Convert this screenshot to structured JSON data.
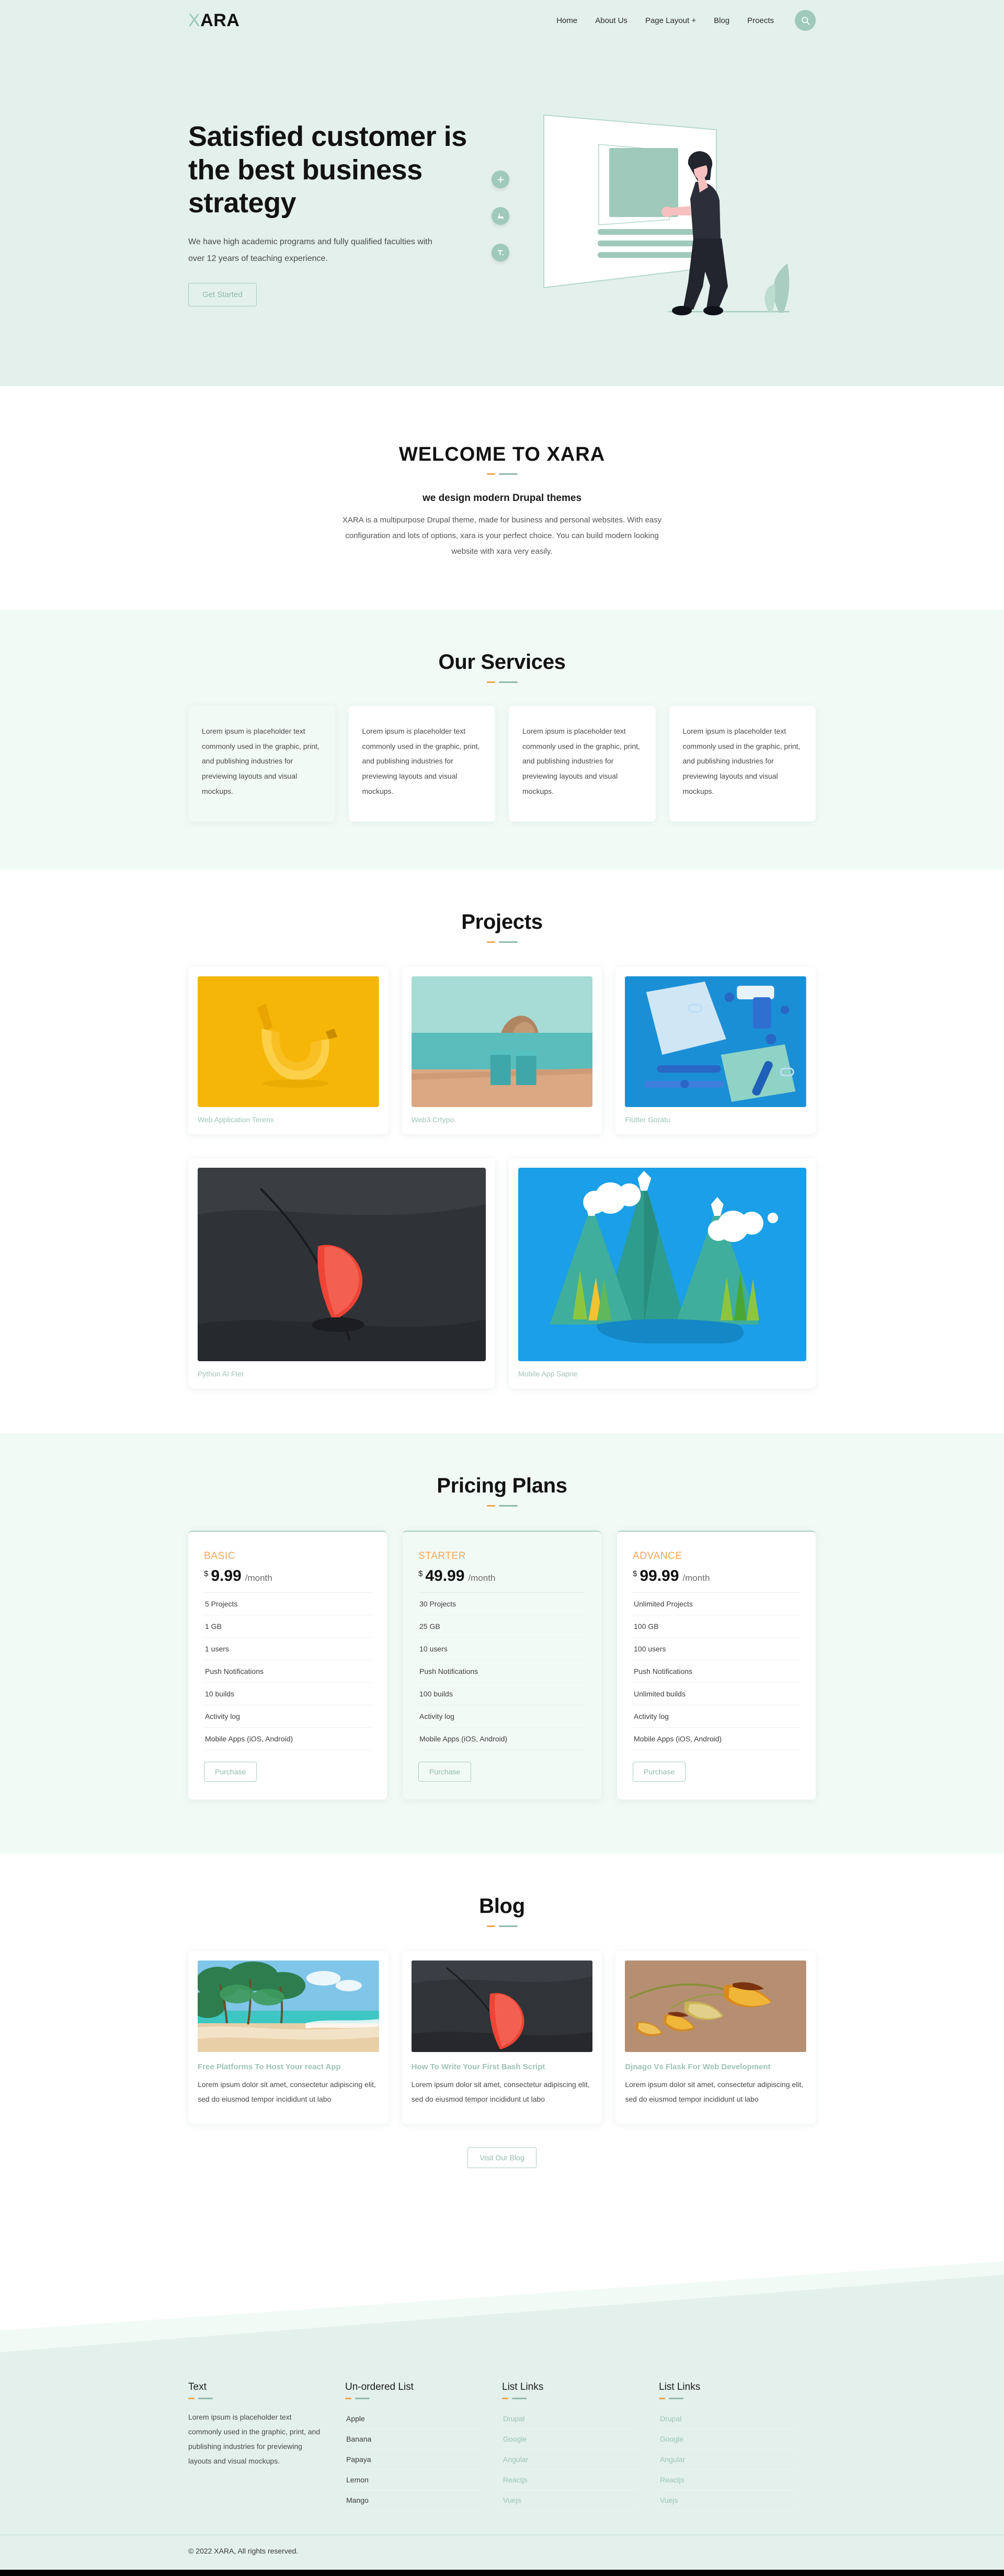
{
  "header": {
    "logo_x": "X",
    "logo_rest": "ARA",
    "nav": [
      {
        "label": "Home"
      },
      {
        "label": "About Us"
      },
      {
        "label": "Page Layout +"
      },
      {
        "label": "Blog"
      },
      {
        "label": "Proects"
      }
    ],
    "search_icon": "search-icon"
  },
  "hero": {
    "heading": "Satisfied customer is the best business strategy",
    "paragraph": "We have high academic programs and fully qualified faculties with over 12 years of teaching experience.",
    "cta": "Get Started",
    "side_icons": [
      {
        "name": "plus-icon",
        "glyph": "+"
      },
      {
        "name": "image-icon",
        "glyph": "image"
      },
      {
        "name": "text-icon",
        "glyph": "T."
      }
    ]
  },
  "welcome": {
    "title": "WELCOME TO XARA",
    "subtitle": "we design modern Drupal themes",
    "body": "XARA is a multipurpose Drupal theme, made for business and personal websites. With easy configuration and lots of options, xara is your perfect choice. You can build modern looking website with xara very easily."
  },
  "services": {
    "title": "Our Services",
    "cards": [
      {
        "text": "Lorem ipsum is placeholder text commonly used in the graphic, print, and publishing industries for previewing layouts and visual mockups."
      },
      {
        "text": "Lorem ipsum is placeholder text commonly used in the graphic, print, and publishing industries for previewing layouts and visual mockups."
      },
      {
        "text": "Lorem ipsum is placeholder text commonly used in the graphic, print, and publishing industries for previewing layouts and visual mockups."
      },
      {
        "text": "Lorem ipsum is placeholder text commonly used in the graphic, print, and publishing industries for previewing layouts and visual mockups."
      }
    ]
  },
  "projects": {
    "title": "Projects",
    "row1": [
      {
        "title": "Web Application Terenx",
        "image": "banana-low-poly-yellow"
      },
      {
        "title": "Web3 Crtypo",
        "image": "beach-chairs-sea-rock"
      },
      {
        "title": "Flutter Goratu",
        "image": "blue-stationery-flatlay"
      }
    ],
    "row2": [
      {
        "title": "Python AI Fter",
        "image": "red-umbrella-on-dark-asphalt"
      },
      {
        "title": "Mobile App Sapne",
        "image": "flat-mountains-trees-clouds"
      }
    ]
  },
  "pricing": {
    "title": "Pricing Plans",
    "currency": "$",
    "period": "/month",
    "purchase_label": "Purchase",
    "plans": [
      {
        "name": "BASIC",
        "amount": "9.99",
        "features": [
          "5 Projects",
          "1 GB",
          "1 users",
          "Push Notifications",
          "10 builds",
          "Activity log",
          "Mobile Apps (iOS, Android)"
        ]
      },
      {
        "name": "STARTER",
        "amount": "49.99",
        "features": [
          "30 Projects",
          "25 GB",
          "10 users",
          "Push Notifications",
          "100 builds",
          "Activity log",
          "Mobile Apps (iOS, Android)"
        ]
      },
      {
        "name": "ADVANCE",
        "amount": "99.99",
        "features": [
          "Unlimited Projects",
          "100 GB",
          "100 users",
          "Push Notifications",
          "Unlimited builds",
          "Activity log",
          "Mobile Apps (iOS, Android)"
        ]
      }
    ]
  },
  "blog": {
    "title": "Blog",
    "cta": "Visit Our Blog",
    "posts": [
      {
        "title": "Free Platforms To Host Your react App",
        "excerpt": "Lorem ipsum dolor sit amet, consectetur adipiscing elit, sed do eiusmod tempor incididunt ut labo",
        "image": "tropical-beach-palms"
      },
      {
        "title": "How To Write Your First Bash Script",
        "excerpt": "Lorem ipsum dolor sit amet, consectetur adipiscing elit, sed do eiusmod tempor incididunt ut labo",
        "image": "red-umbrella-on-dark-asphalt"
      },
      {
        "title": "Djnago Vs Flask For Web Development",
        "excerpt": "Lorem ipsum dolor sit amet, consectetur adipiscing elit, sed do eiusmod tempor incididunt ut labo",
        "image": "wheat-stalks-brown"
      }
    ]
  },
  "footer": {
    "columns": [
      {
        "heading": "Text",
        "type": "text",
        "body": "Lorem ipsum is placeholder text commonly used in the graphic, print, and publishing industries for previewing layouts and visual mockups."
      },
      {
        "heading": "Un-ordered List",
        "type": "list",
        "items": [
          "Apple",
          "Banana",
          "Papaya",
          "Lemon",
          "Mango"
        ]
      },
      {
        "heading": "List Links",
        "type": "links",
        "items": [
          "Drupal",
          "Google",
          "Angular",
          "Reactjs",
          "Vuejs"
        ]
      },
      {
        "heading": "List Links",
        "type": "links",
        "items": [
          "Drupal",
          "Google",
          "Angular",
          "Reactjs",
          "Vuejs"
        ]
      }
    ],
    "copyright": "© 2022 XARA, All rights reserved."
  },
  "colors": {
    "brand_mint": "#e3f0ec",
    "brand_green": "#9fc9ba",
    "accent_orange": "#f0a64a",
    "muted_link": "#9ec4b6"
  }
}
